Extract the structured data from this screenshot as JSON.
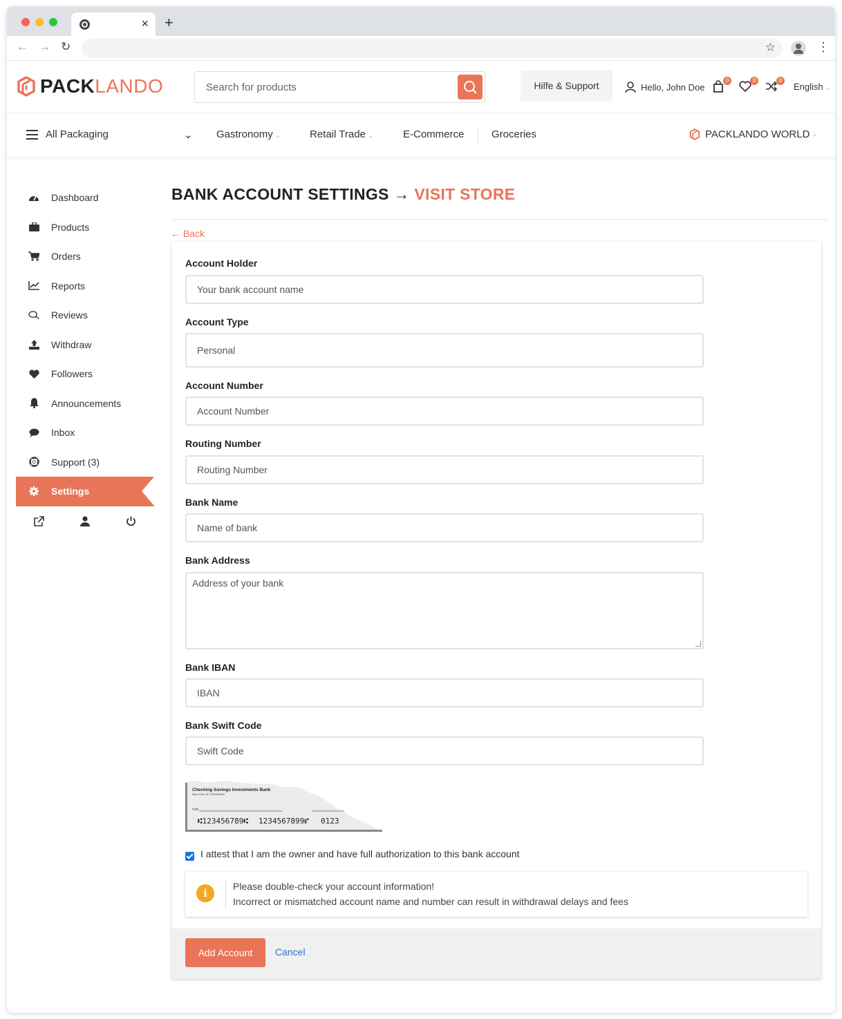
{
  "browser": {
    "tab_close": "×",
    "new_tab": "+",
    "back": "←",
    "forward": "→",
    "reload": "↻",
    "star": "☆",
    "menu": "⋮"
  },
  "header": {
    "logo_part1": "PACK",
    "logo_part2": "LANDO",
    "search_placeholder": "Search for products",
    "support_label": "Hilfe & Support",
    "user_greeting": "Hello, John Doe",
    "cart_count": "0",
    "wishlist_count": "0",
    "compare_count": "0",
    "language": "English",
    "brand_color": "#e97559"
  },
  "catnav": {
    "all_label": "All Packaging",
    "items": [
      "Gastronomy",
      "Retail Trade",
      "E-Commerce",
      "Groceries"
    ],
    "world_label": "PACKLANDO WORLD"
  },
  "sidebar": {
    "items": [
      {
        "label": "Dashboard",
        "icon": "dashboard-icon"
      },
      {
        "label": "Products",
        "icon": "briefcase-icon"
      },
      {
        "label": "Orders",
        "icon": "cart-icon"
      },
      {
        "label": "Reports",
        "icon": "chart-icon"
      },
      {
        "label": "Reviews",
        "icon": "comments-icon"
      },
      {
        "label": "Withdraw",
        "icon": "upload-icon"
      },
      {
        "label": "Followers",
        "icon": "heart-icon"
      },
      {
        "label": "Announcements",
        "icon": "bell-icon"
      },
      {
        "label": "Inbox",
        "icon": "chat-icon"
      },
      {
        "label": "Support (3)",
        "icon": "lifebuoy-icon"
      },
      {
        "label": "Settings",
        "icon": "gear-icon",
        "active": true
      }
    ]
  },
  "page": {
    "title_main": "BANK ACCOUNT SETTINGS",
    "title_arrow": "→",
    "title_link": "VISIT STORE",
    "back_label": "← Back"
  },
  "form": {
    "fields": [
      {
        "label": "Account Holder",
        "placeholder": "Your bank account name"
      },
      {
        "label": "Account Type",
        "value": "Personal"
      },
      {
        "label": "Account Number",
        "placeholder": "Account Number"
      },
      {
        "label": "Routing Number",
        "placeholder": "Routing Number"
      },
      {
        "label": "Bank Name",
        "placeholder": "Name of bank"
      },
      {
        "label": "Bank Address",
        "placeholder": "Address of your bank"
      },
      {
        "label": "Bank IBAN",
        "placeholder": "IBAN"
      },
      {
        "label": "Bank Swift Code",
        "placeholder": "Swift Code"
      }
    ],
    "check_image": {
      "bank_name": "Checking Savings Investments Bank",
      "bank_city": "New York, NY 12345-6000",
      "for_label": "FOR",
      "routing": "⑆123456789⑆",
      "account": "1234567899⑈",
      "check_no": "0123"
    },
    "attest_label": "I attest that I am the owner and have full authorization to this bank account",
    "attest_checked": true,
    "notice_line1": "Please double-check your account information!",
    "notice_line2": "Incorrect or mismatched account name and number can result in withdrawal delays and fees",
    "submit_label": "Add Account",
    "cancel_label": "Cancel"
  }
}
